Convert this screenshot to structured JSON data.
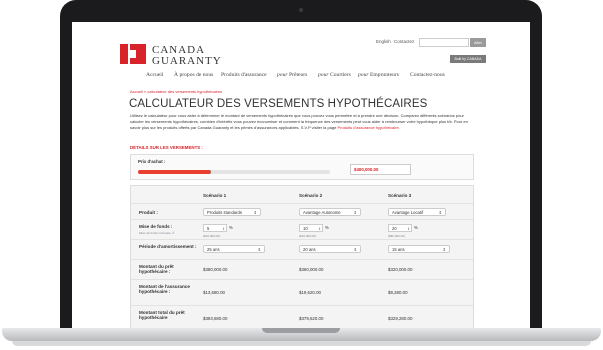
{
  "header": {
    "brand_line1": "CANADA",
    "brand_line2": "GUARANTY",
    "lang_english": "English",
    "lang_contact": "Contactez",
    "search_button": "Aller",
    "cert_badge": "Built by CANADA"
  },
  "nav": {
    "items": [
      "Accueil",
      "À propos de nous",
      "Produits d'assurance",
      "pour",
      "Prêteurs",
      "pour",
      "Courtiers",
      "pour",
      "Emprunteurs",
      "Contactez-nous"
    ]
  },
  "breadcrumb": "Accueil » calculateur des versements hypothécaires",
  "page_title": "CALCULATEUR DES VERSEMENTS HYPOTHÉCAIRES",
  "intro": {
    "text": "Utilisez le calculateur pour vous aider à déterminer le montant de versements hypothécaires que vous pouvez vous permettre et à prendre une décision. Comparez différents scénarios pour calculer les versements hypothécaires, combien d'intérêts vous pouvez économiser et comment la fréquence des versements peut vous aider à rembourser votre hypothèque plus tôt. Pour en savoir plus sur les produits offerts par Canada Guaranty et les primes d'assurances applicables, S.V.P visiter la page",
    "link": "Produits d'assurance hypothécaire."
  },
  "details_heading": "DÉTAILS SUR LES VERSEMENTS :",
  "price": {
    "label": "Prix d'achat :",
    "value": "$400,000.00",
    "slider_fraction": 0.38
  },
  "scenarios": {
    "headers": [
      "Scénario 1",
      "Scénario 2",
      "Scénario 3"
    ],
    "labels": {
      "product": "Produit :",
      "down_payment": "Mise de fonds :",
      "down_payment_sub": "Mise de fonds minimale",
      "amortization": "Période d'amortissement :",
      "loan_amount": "Montant du prêt hypothécaire :",
      "insurance_amount": "Montant de l'assurance hypothécaire :",
      "total_amount": "Montant total du prêt hypothécaire"
    },
    "products": [
      "Produits standards",
      "Avantage Autonome",
      "Avantage Locatif"
    ],
    "down_pct": [
      "5",
      "10",
      "20"
    ],
    "pct_sign": "%",
    "down_amounts": [
      "($20,000.00)",
      "($40,000.00)",
      "($80,000.00)"
    ],
    "amortization": [
      "25 ans",
      "20 ans",
      "15 ans"
    ],
    "loan_amounts": [
      "$380,000.00",
      "$360,000.00",
      "$320,000.00"
    ],
    "insurance_amounts": [
      "$13,680.00",
      "$19,620.00",
      "$9,280.00"
    ],
    "total_amounts": [
      "$393,680.00",
      "$379,620.00",
      "$329,280.00"
    ]
  },
  "colors": {
    "accent": "#d8232a",
    "slider": "#e8402f"
  },
  "icons": {
    "info": "info-triangle-icon",
    "chevron": "chevron-updown-icon"
  }
}
